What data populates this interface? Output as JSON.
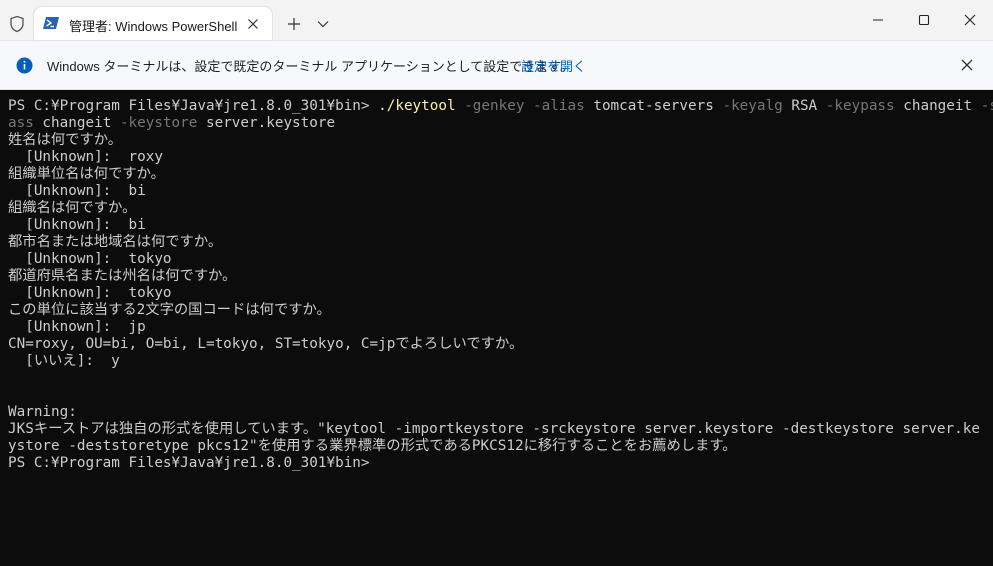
{
  "window": {
    "tab_title": "管理者: Windows PowerShell"
  },
  "infobar": {
    "message": "Windows ターミナルは、設定で既定のターミナル アプリケーションとして設定できます。",
    "link": "設定を開く"
  },
  "terminal": {
    "command": {
      "prompt": "PS C:¥Program Files¥Java¥jre1.8.0_301¥bin> ",
      "exe": "./keytool",
      "line1_rest": [
        {
          "t": "param",
          "v": " -genkey"
        },
        {
          "t": "param",
          "v": " -alias"
        },
        {
          "t": "arg",
          "v": " tomcat-servers"
        },
        {
          "t": "param",
          "v": " -keyalg"
        },
        {
          "t": "arg",
          "v": " RSA"
        },
        {
          "t": "param",
          "v": " -keypass"
        },
        {
          "t": "arg",
          "v": " changeit"
        },
        {
          "t": "param",
          "v": " -storep"
        }
      ],
      "line2": [
        {
          "t": "param",
          "v": "ass"
        },
        {
          "t": "arg",
          "v": " changeit"
        },
        {
          "t": "param",
          "v": " -keystore"
        },
        {
          "t": "arg",
          "v": " server.keystore"
        }
      ]
    },
    "output_lines": [
      "姓名は何ですか。",
      "  [Unknown]:  roxy",
      "組織単位名は何ですか。",
      "  [Unknown]:  bi",
      "組織名は何ですか。",
      "  [Unknown]:  bi",
      "都市名または地域名は何ですか。",
      "  [Unknown]:  tokyo",
      "都道府県名または州名は何ですか。",
      "  [Unknown]:  tokyo",
      "この単位に該当する2文字の国コードは何ですか。",
      "  [Unknown]:  jp",
      "CN=roxy, OU=bi, O=bi, L=tokyo, ST=tokyo, C=jpでよろしいですか。",
      "  [いいえ]:  y",
      "",
      "",
      "Warning:",
      "JKSキーストアは独自の形式を使用しています。\"keytool -importkeystore -srckeystore server.keystore -destkeystore server.ke",
      "ystore -deststoretype pkcs12\"を使用する業界標準の形式であるPKCS12に移行することをお薦めします。",
      "PS C:¥Program Files¥Java¥jre1.8.0_301¥bin>"
    ]
  },
  "colors": {
    "terminal_bg": "#0c0c0c",
    "terminal_text": "#cccccc",
    "command": "#f9f1a5",
    "parameter": "#767676",
    "link": "#0067c0",
    "info_icon": "#005fb8"
  }
}
